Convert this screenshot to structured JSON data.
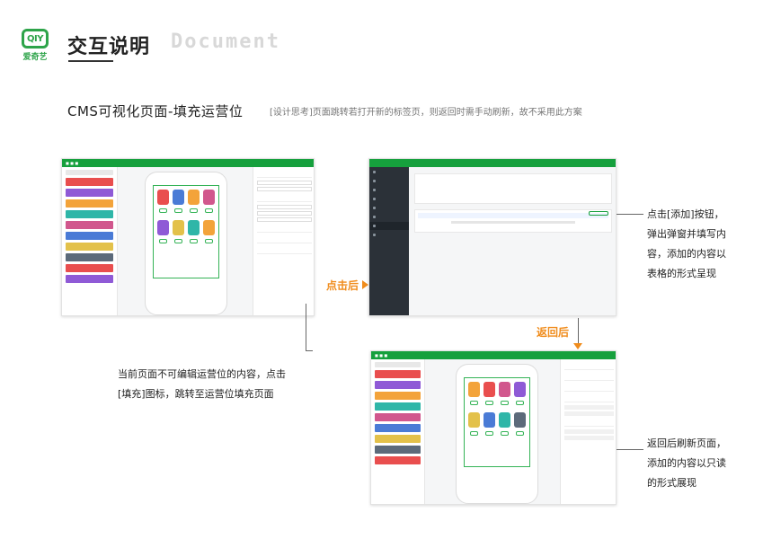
{
  "brand": {
    "logo_letters": "QIY",
    "logo_caption": "爱奇艺",
    "accent": "#2ea44a",
    "highlight": "#f08c1c"
  },
  "header": {
    "title": "交互说明",
    "subtitle": "Document"
  },
  "section": {
    "title": "CMS可视化页面-填充运营位",
    "note": "[设计思考]页面跳转若打开新的标签页，则返回时需手动刷新，故不采用此方案"
  },
  "flow": {
    "after_click": "点击后",
    "after_return": "返回后"
  },
  "descriptions": {
    "left": [
      "当前页面不可编辑运营位的内容，点击",
      "[填充]图标，跳转至运营位填充页面"
    ],
    "right_top": [
      "点击[添加]按钮，",
      "弹出弹窗并填写内",
      "容，添加的内容以",
      "表格的形式呈现"
    ],
    "right_bottom": [
      "返回后刷新页面，",
      "添加的内容以只读",
      "的形式展现"
    ]
  }
}
